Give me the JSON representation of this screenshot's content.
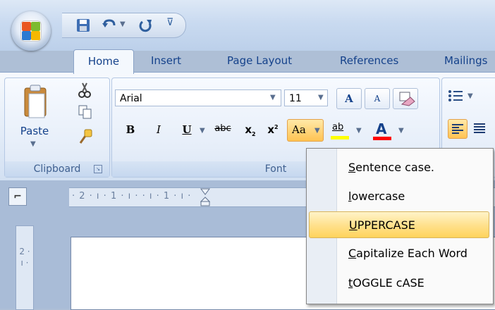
{
  "ribbon": {
    "tabs": [
      "Home",
      "Insert",
      "Page Layout",
      "References",
      "Mailings"
    ],
    "clipboard": {
      "paste_label": "Paste",
      "group_label": "Clipboard"
    },
    "font": {
      "family": "Arial",
      "size": "11",
      "grow_label": "A",
      "shrink_label": "A",
      "bold": "B",
      "italic": "I",
      "underline": "U",
      "strike": "abc",
      "subscript": "x",
      "superscript": "x",
      "change_case": "Aa",
      "highlight": "ab",
      "font_color": "A",
      "group_label": "Font"
    }
  },
  "ruler": {
    "horizontal": "· 2 · ı · 1 · ı ·   · ı · 1 · ı ·",
    "vertical": "2 · ı ·"
  },
  "change_case_menu": {
    "items": [
      {
        "label_u": "S",
        "label_rest": "entence case."
      },
      {
        "label_u": "l",
        "label_rest": "owercase"
      },
      {
        "label_u": "U",
        "label_rest": "PPERCASE"
      },
      {
        "label_u": "C",
        "label_rest": "apitalize Each Word"
      },
      {
        "label_u": "t",
        "label_rest": "OGGLE cASE"
      }
    ],
    "selected": "UPPERCASE"
  },
  "colors": {
    "highlight": "#ffff00",
    "font_color": "#ff0000",
    "accent": "#15428b"
  }
}
